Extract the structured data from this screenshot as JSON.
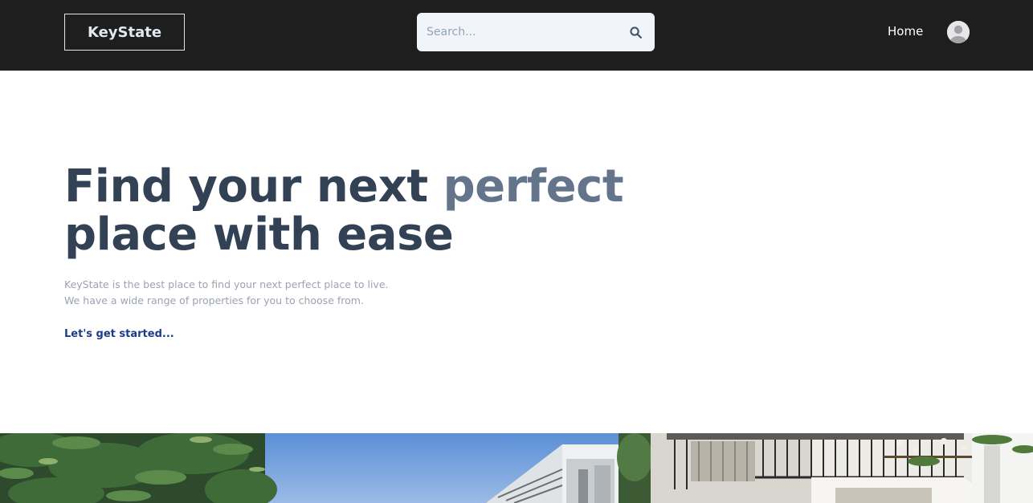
{
  "header": {
    "logo_text": "KeyState",
    "search_placeholder": "Search...",
    "nav_home": "Home"
  },
  "hero": {
    "title_part1": "Find your next ",
    "title_accent": "perfect",
    "title_part2": "place with ease",
    "description_line1": "KeyState is the best place to find your next perfect place to live.",
    "description_line2": "We have a wide range of properties for you to choose from.",
    "cta_label": "Let's get started..."
  },
  "colors": {
    "header_bg": "#1e1e1e",
    "title": "#334155",
    "title_accent": "#64748b",
    "description": "#9ca3af",
    "cta": "#1e3a8a",
    "search_bg": "#f1f5f9"
  },
  "icons": {
    "search": "search-icon",
    "avatar": "user-avatar-icon"
  }
}
